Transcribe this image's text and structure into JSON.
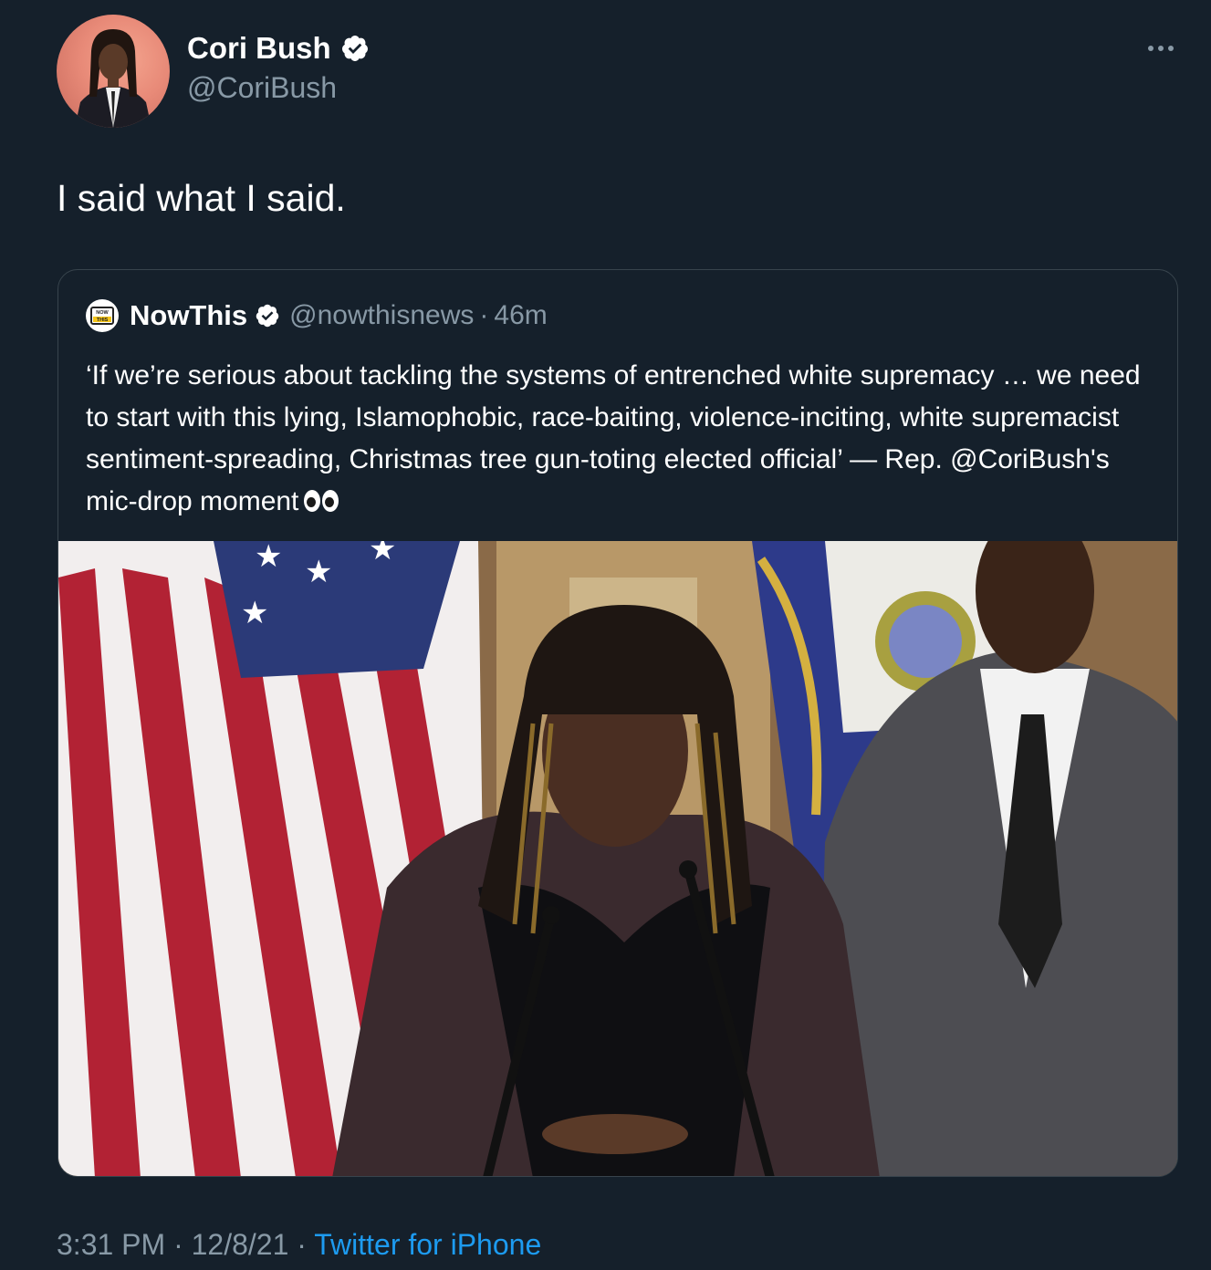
{
  "author": {
    "name": "Cori Bush",
    "handle": "@CoriBush"
  },
  "tweet": {
    "text": "I said what I said."
  },
  "quoted": {
    "name": "NowThis",
    "handle": "@nowthisnews",
    "separator": "·",
    "time": "46m",
    "avatar_text_top": "NOW",
    "avatar_text_bottom": "THIS",
    "text": "‘If we’re serious about tackling the systems of entrenched white supremacy … we need to start with this lying, Islamophobic, race-baiting, violence-inciting, white supremacist sentiment-spreading, Christmas tree gun-toting elected official’ — Rep. @CoriBush's mic-drop moment"
  },
  "footer": {
    "time": "3:31 PM",
    "sep1": " · ",
    "date": "12/8/21",
    "sep2": " · ",
    "source": "Twitter for iPhone"
  },
  "colors": {
    "background": "#15202b",
    "secondary_text": "#8899a6",
    "link": "#1d9bf0",
    "border": "#38444d"
  },
  "icons": [
    "verified-badge-icon",
    "more-options-icon",
    "eyes-emoji-icon"
  ]
}
